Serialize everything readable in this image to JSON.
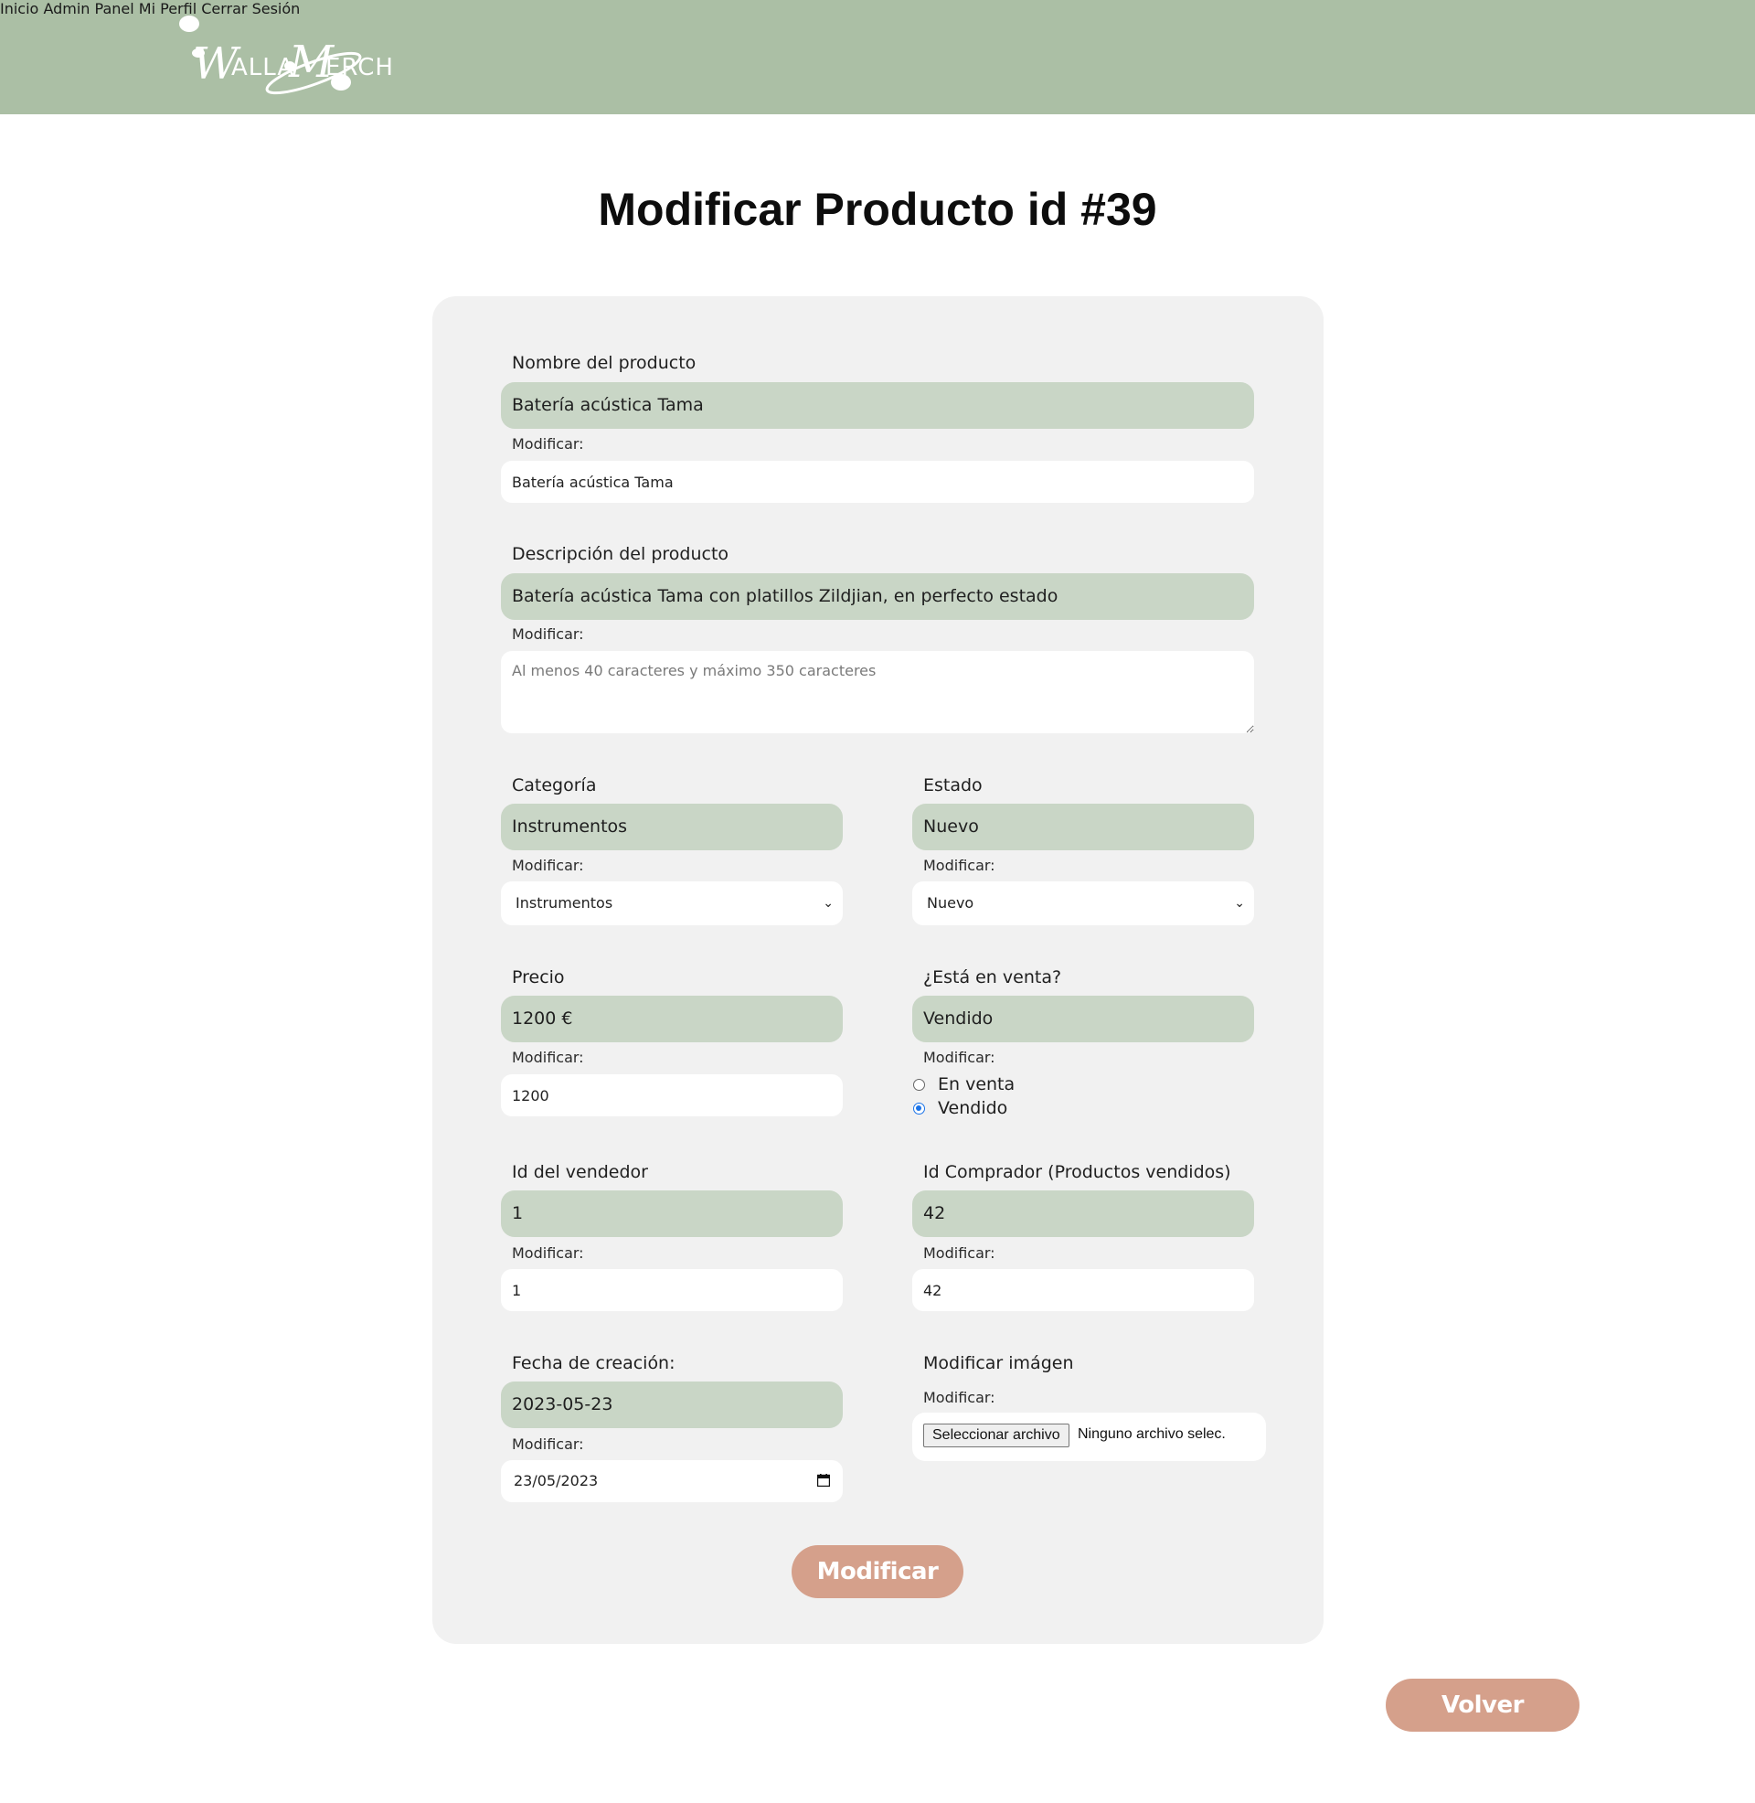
{
  "header": {
    "logo_text": "WALLAMERCH",
    "nav": [
      {
        "label": "Inicio"
      },
      {
        "label": "Admin Panel"
      },
      {
        "label": "Mi Perfil"
      },
      {
        "label": "Cerrar Sesión"
      }
    ]
  },
  "page": {
    "title": "Modificar Producto id #39"
  },
  "form": {
    "modify_label": "Modificar:",
    "nombre": {
      "label": "Nombre del producto",
      "current": "Batería acústica Tama",
      "value": "Batería acústica Tama"
    },
    "descripcion": {
      "label": "Descripción del producto",
      "current": "Batería acústica Tama con platillos Zildjian, en perfecto estado",
      "placeholder": "Al menos 40 caracteres y máximo 350 caracteres"
    },
    "categoria": {
      "label": "Categoría",
      "current": "Instrumentos",
      "selected": "Instrumentos"
    },
    "estado": {
      "label": "Estado",
      "current": "Nuevo",
      "selected": "Nuevo"
    },
    "precio": {
      "label": "Precio",
      "current": "1200 €",
      "value": "1200"
    },
    "en_venta": {
      "label": "¿Está en venta?",
      "current": "Vendido",
      "options": [
        {
          "label": "En venta",
          "checked": false
        },
        {
          "label": "Vendido",
          "checked": true
        }
      ]
    },
    "vendedor": {
      "label": "Id del vendedor",
      "current": "1",
      "value": "1"
    },
    "comprador": {
      "label": "Id Comprador (Productos vendidos)",
      "current": "42",
      "value": "42"
    },
    "fecha": {
      "label": "Fecha de creación:",
      "current": "2023-05-23",
      "value": "23/05/2023"
    },
    "imagen": {
      "label": "Modificar imágen",
      "file_button": "Seleccionar archivo",
      "file_status": "Ninguno archivo selec."
    },
    "submit_label": "Modificar"
  },
  "back_label": "Volver",
  "colors": {
    "header_bg": "#abbfa5",
    "current_value_bg": "#c9d6c6",
    "card_bg": "#f1f1f1",
    "button_bg": "#d5a08b",
    "radio_accent": "#1a73e8"
  },
  "icons": [
    "logo-mark",
    "chevron-down-icon",
    "calendar-icon",
    "radio-icon"
  ]
}
